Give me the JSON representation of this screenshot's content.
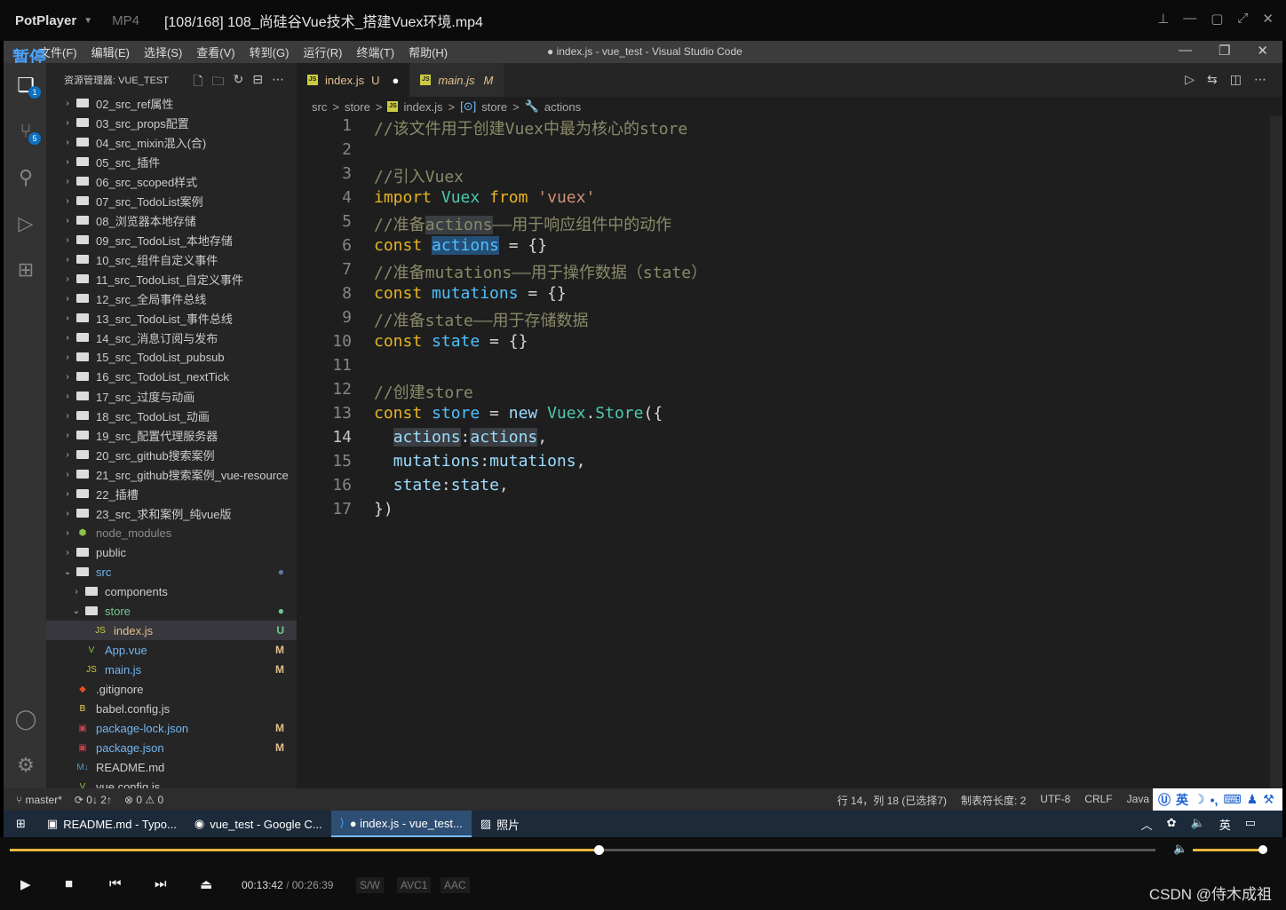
{
  "player": {
    "app": "PotPlayer",
    "format": "MP4",
    "file_title": "[108/168] 108_尚硅谷Vue技术_搭建Vuex环境.mp4",
    "time_current": "00:13:42",
    "time_sep": "/",
    "time_total": "00:26:39",
    "tags": [
      "S/W",
      "AVC1",
      "AAC"
    ],
    "progress_fraction": 0.514,
    "watermark": "CSDN @侍木成祖"
  },
  "vscode": {
    "pause_overlay": "暂停",
    "menu": [
      "文件(F)",
      "编辑(E)",
      "选择(S)",
      "查看(V)",
      "转到(G)",
      "运行(R)",
      "终端(T)",
      "帮助(H)"
    ],
    "window_title": "● index.js - vue_test - Visual Studio Code",
    "activity_badges": {
      "explorer": "1",
      "scm": "5"
    },
    "explorer_title": "资源管理器: VUE_TEST",
    "tree": [
      {
        "label": "02_src_ref属性",
        "type": "folder",
        "depth": 0,
        "status": ""
      },
      {
        "label": "03_src_props配置",
        "type": "folder",
        "depth": 0,
        "status": ""
      },
      {
        "label": "04_src_mixin混入(合)",
        "type": "folder",
        "depth": 0,
        "status": ""
      },
      {
        "label": "05_src_插件",
        "type": "folder",
        "depth": 0,
        "status": ""
      },
      {
        "label": "06_src_scoped样式",
        "type": "folder",
        "depth": 0,
        "status": ""
      },
      {
        "label": "07_src_TodoList案例",
        "type": "folder",
        "depth": 0,
        "status": ""
      },
      {
        "label": "08_浏览器本地存储",
        "type": "folder",
        "depth": 0,
        "status": ""
      },
      {
        "label": "09_src_TodoList_本地存储",
        "type": "folder",
        "depth": 0,
        "status": ""
      },
      {
        "label": "10_src_组件自定义事件",
        "type": "folder",
        "depth": 0,
        "status": ""
      },
      {
        "label": "11_src_TodoList_自定义事件",
        "type": "folder",
        "depth": 0,
        "status": ""
      },
      {
        "label": "12_src_全局事件总线",
        "type": "folder",
        "depth": 0,
        "status": ""
      },
      {
        "label": "13_src_TodoList_事件总线",
        "type": "folder",
        "depth": 0,
        "status": ""
      },
      {
        "label": "14_src_消息订阅与发布",
        "type": "folder",
        "depth": 0,
        "status": ""
      },
      {
        "label": "15_src_TodoList_pubsub",
        "type": "folder",
        "depth": 0,
        "status": ""
      },
      {
        "label": "16_src_TodoList_nextTick",
        "type": "folder",
        "depth": 0,
        "status": ""
      },
      {
        "label": "17_src_过度与动画",
        "type": "folder",
        "depth": 0,
        "status": ""
      },
      {
        "label": "18_src_TodoList_动画",
        "type": "folder",
        "depth": 0,
        "status": ""
      },
      {
        "label": "19_src_配置代理服务器",
        "type": "folder",
        "depth": 0,
        "status": ""
      },
      {
        "label": "20_src_github搜索案例",
        "type": "folder",
        "depth": 0,
        "status": ""
      },
      {
        "label": "21_src_github搜索案例_vue-resource",
        "type": "folder",
        "depth": 0,
        "status": ""
      },
      {
        "label": "22_插槽",
        "type": "folder",
        "depth": 0,
        "status": ""
      },
      {
        "label": "23_src_求和案例_纯vue版",
        "type": "folder",
        "depth": 0,
        "status": ""
      },
      {
        "label": "node_modules",
        "type": "node",
        "depth": 0,
        "status": ""
      },
      {
        "label": "public",
        "type": "folder",
        "depth": 0,
        "status": ""
      },
      {
        "label": "src",
        "type": "folder-open",
        "depth": 0,
        "status": "●"
      },
      {
        "label": "components",
        "type": "folder",
        "depth": 1,
        "status": ""
      },
      {
        "label": "store",
        "type": "folder-open",
        "depth": 1,
        "status": "●"
      },
      {
        "label": "index.js",
        "type": "js",
        "depth": 2,
        "status": "U"
      },
      {
        "label": "App.vue",
        "type": "vue",
        "depth": 1,
        "status": "M"
      },
      {
        "label": "main.js",
        "type": "js",
        "depth": 1,
        "status": "M"
      },
      {
        "label": ".gitignore",
        "type": "git",
        "depth": 0,
        "status": ""
      },
      {
        "label": "babel.config.js",
        "type": "babel",
        "depth": 0,
        "status": ""
      },
      {
        "label": "package-lock.json",
        "type": "json",
        "depth": 0,
        "status": "M"
      },
      {
        "label": "package.json",
        "type": "json",
        "depth": 0,
        "status": "M"
      },
      {
        "label": "README.md",
        "type": "md",
        "depth": 0,
        "status": ""
      },
      {
        "label": "vue.config.js",
        "type": "vue",
        "depth": 0,
        "status": ""
      }
    ],
    "tabs": [
      {
        "label": "index.js",
        "status": "U",
        "dirty": "●"
      },
      {
        "label": "main.js",
        "status": "M",
        "dirty": ""
      }
    ],
    "breadcrumb": [
      "src",
      ">",
      "store",
      ">",
      "index.js",
      ">",
      "store",
      ">",
      "actions"
    ],
    "code_lines": [
      "1",
      "2",
      "3",
      "4",
      "5",
      "6",
      "7",
      "8",
      "9",
      "10",
      "11",
      "12",
      "13",
      "14",
      "15",
      "16",
      "17"
    ],
    "status": {
      "branch": "master*",
      "sync": "0↓ 2↑",
      "problems": "⊗ 0 ⚠ 0",
      "position": "行 14，列 18 (已选择7)",
      "tab_size": "制表符长度: 2",
      "encoding": "UTF-8",
      "eol": "CRLF",
      "lang": "Java",
      "ime": "英"
    }
  },
  "taskbar": {
    "items": [
      "README.md - Typo...",
      "vue_test - Google C...",
      "● index.js - vue_test...",
      "照片"
    ],
    "ime": "英"
  }
}
